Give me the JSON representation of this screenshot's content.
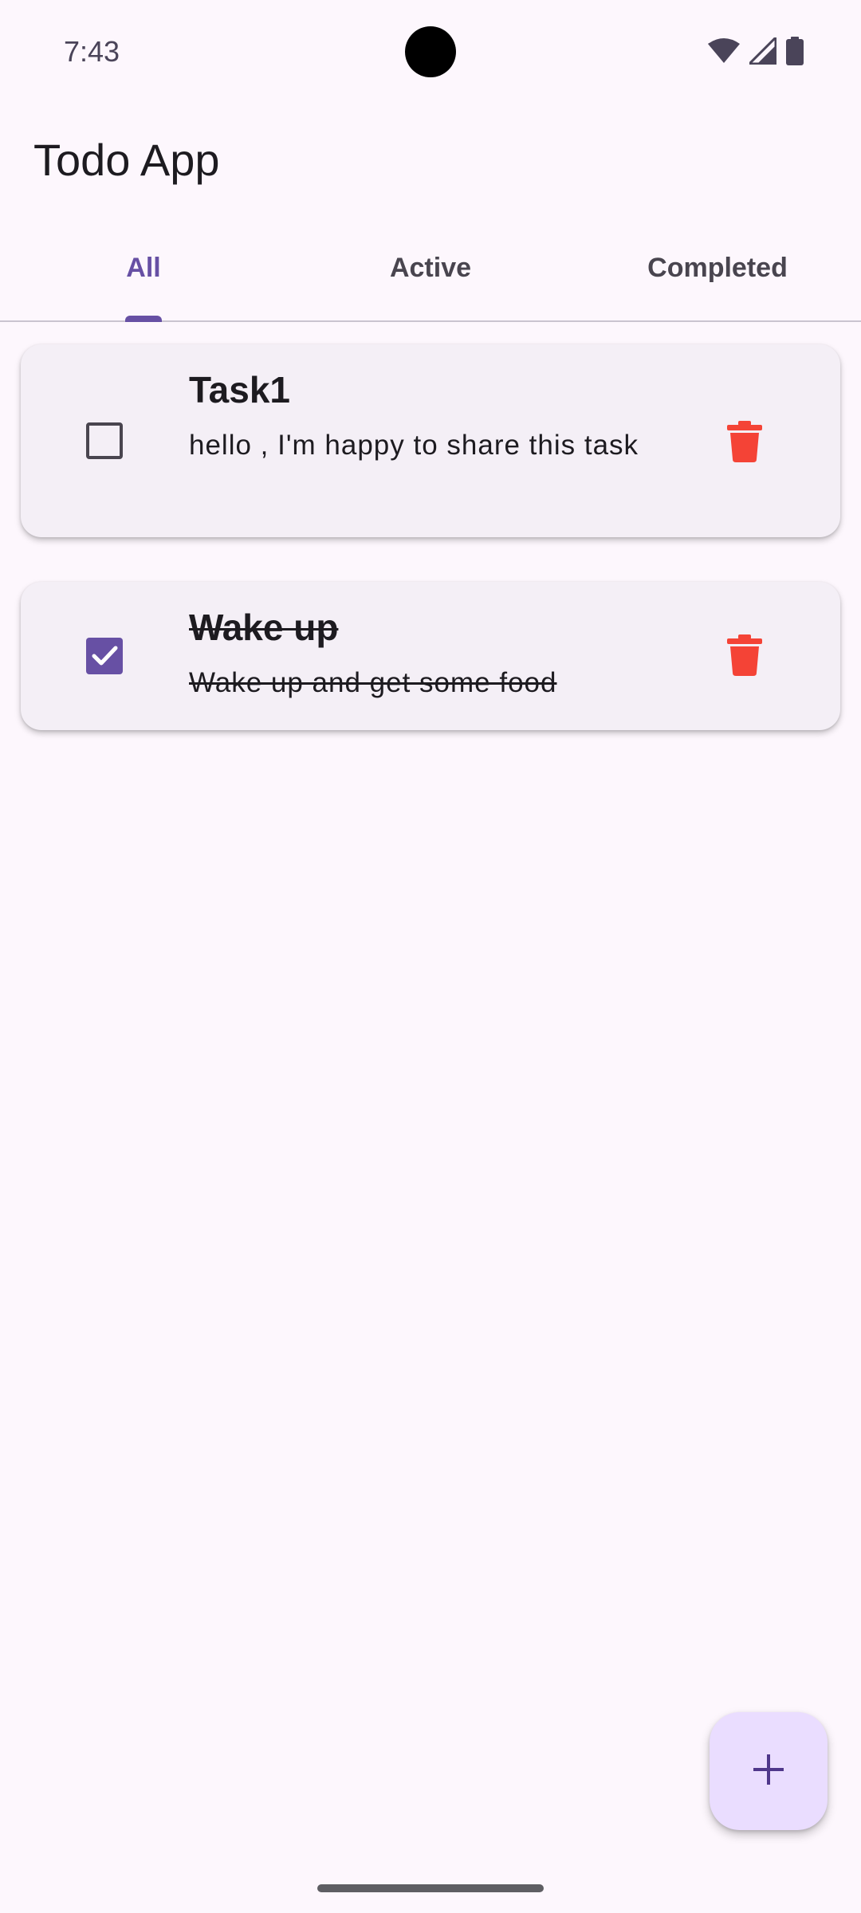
{
  "status_bar": {
    "time": "7:43",
    "icons": [
      "wifi-icon",
      "signal-icon",
      "battery-icon"
    ]
  },
  "app_bar": {
    "title": "Todo App"
  },
  "tabs": [
    {
      "label": "All",
      "selected": true
    },
    {
      "label": "Active",
      "selected": false
    },
    {
      "label": "Completed",
      "selected": false
    }
  ],
  "tasks": [
    {
      "title": "Task1",
      "description": "hello , I'm happy to share this task",
      "completed": false
    },
    {
      "title": "Wake up",
      "description": "Wake up and get some food",
      "completed": true
    }
  ],
  "fab": {
    "icon": "plus-icon"
  },
  "colors": {
    "accent": "#6750a4",
    "background": "#fdf7fd",
    "card": "#f4eff6",
    "delete": "#f44336",
    "fab": "#eaddff"
  }
}
